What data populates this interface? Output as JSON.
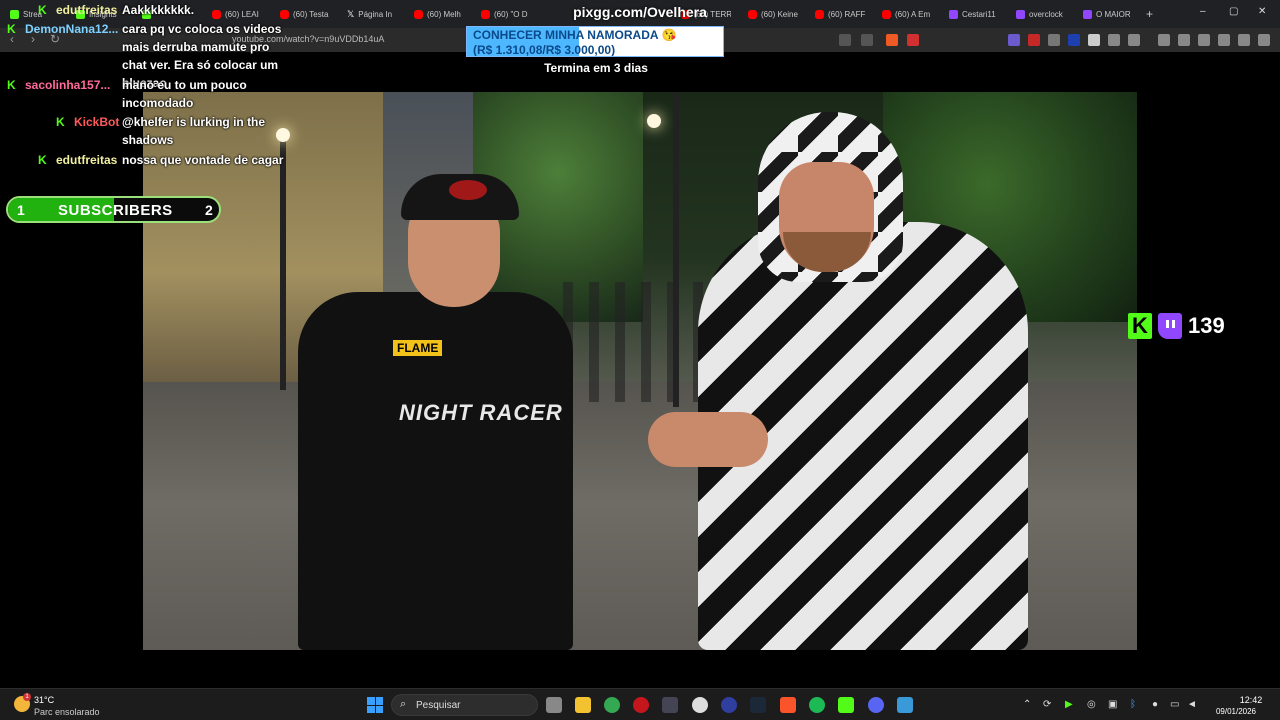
{
  "browser": {
    "tabs": [
      {
        "label": "Strea",
        "icon": "kick-icon"
      },
      {
        "label": "Insights",
        "icon": "kick-icon"
      },
      {
        "label": "",
        "icon": "kick-icon"
      },
      {
        "label": "(60) LEAI",
        "icon": "youtube-icon"
      },
      {
        "label": "(60) Testa",
        "icon": "youtube-icon"
      },
      {
        "label": "Página In",
        "icon": "x-icon"
      },
      {
        "label": "(60) Melh",
        "icon": "youtube-icon"
      },
      {
        "label": "(60) \"O D",
        "icon": "youtube-icon"
      },
      {
        "label": "(60) TERR",
        "icon": "youtube-icon"
      },
      {
        "label": "(60) Keine",
        "icon": "youtube-icon"
      },
      {
        "label": "(60) RAFF",
        "icon": "youtube-icon"
      },
      {
        "label": "(60) A Em",
        "icon": "youtube-icon"
      },
      {
        "label": "Cestari11",
        "icon": "twitch-icon"
      },
      {
        "label": "overclock",
        "icon": "twitch-icon"
      },
      {
        "label": "O MAIOR",
        "icon": "twitch-icon"
      }
    ],
    "new_tab": "+",
    "url": "youtube.com/watch?v=n9uVDDb14uA"
  },
  "overlay": {
    "pix_url": "pixgg.com/Ovelhera",
    "goal": {
      "title": "CONHECER MINHA NAMORADA 😘",
      "amount": "(R$ 1.310,08/R$ 3.000,00)",
      "progress": 0.4367,
      "ends": "Termina em 3 dias"
    },
    "subs": {
      "current": "1",
      "label": "SUBSCRIBERS",
      "target": "2",
      "progress": 0.5
    },
    "viewers": {
      "count": "139"
    },
    "chat": [
      {
        "user": "edutfreitas",
        "message": "Aakkkkkkkk.",
        "color": "#f0f0a0"
      },
      {
        "user": "DemonNana12...",
        "message": "cara pq vc coloca os videos mais derruba mamute pro chat ver. Era só colocar um bluezao",
        "color": "#7dd1ff"
      },
      {
        "user": "sacolinha157...",
        "message": "mano eu to um pouco incomodado",
        "color": "#ff6b9a"
      },
      {
        "user": "KickBot",
        "message": "@khelfer is lurking in the shadows",
        "color": "#ff5a5a"
      },
      {
        "user": "edutfreitas",
        "message": "nossa que vontade de cagar",
        "color": "#f0f0a0"
      }
    ]
  },
  "taskbar": {
    "weather": {
      "temp": "31°C",
      "desc": "Parc ensolarado",
      "badge": "1"
    },
    "search_placeholder": "Pesquisar",
    "clock": {
      "time": "12:42",
      "date": "09/01/2026"
    }
  }
}
